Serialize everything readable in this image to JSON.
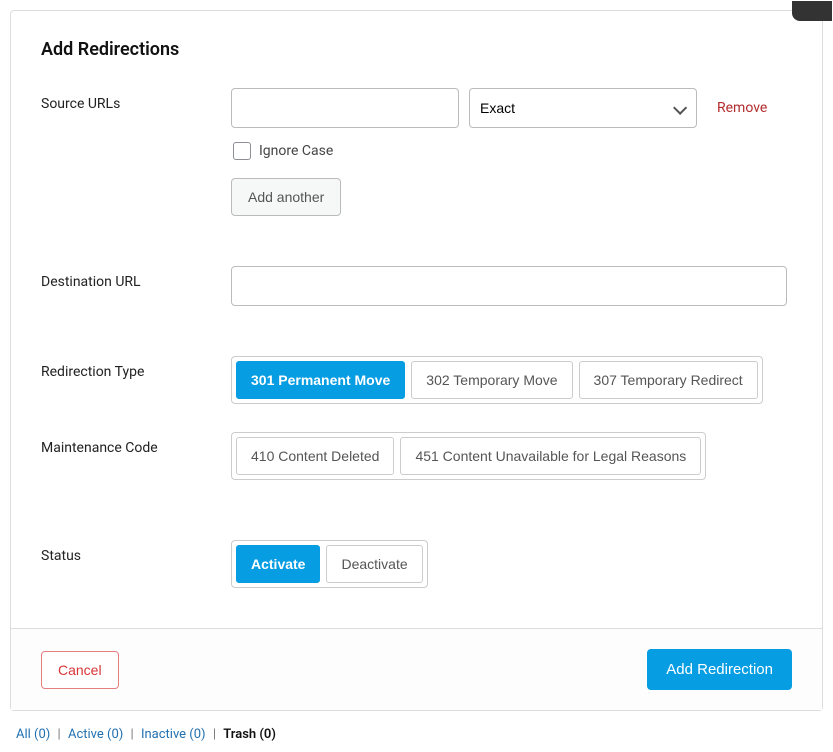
{
  "title": "Add Redirections",
  "labels": {
    "source_urls": "Source URLs",
    "destination_url": "Destination URL",
    "redirection_type": "Redirection Type",
    "maintenance_code": "Maintenance Code",
    "status": "Status"
  },
  "source": {
    "url_value": "",
    "match_type": "Exact",
    "remove": "Remove",
    "ignore_case": "Ignore Case",
    "add_another": "Add another"
  },
  "destination": {
    "value": ""
  },
  "redirection_types": {
    "r301": "301 Permanent Move",
    "r302": "302 Temporary Move",
    "r307": "307 Temporary Redirect"
  },
  "maintenance_codes": {
    "r410": "410 Content Deleted",
    "r451": "451 Content Unavailable for Legal Reasons"
  },
  "status": {
    "activate": "Activate",
    "deactivate": "Deactivate"
  },
  "footer": {
    "cancel": "Cancel",
    "add": "Add Redirection"
  },
  "filters": {
    "all": "All (0)",
    "active": "Active (0)",
    "inactive": "Inactive (0)",
    "trash": "Trash (0)"
  }
}
